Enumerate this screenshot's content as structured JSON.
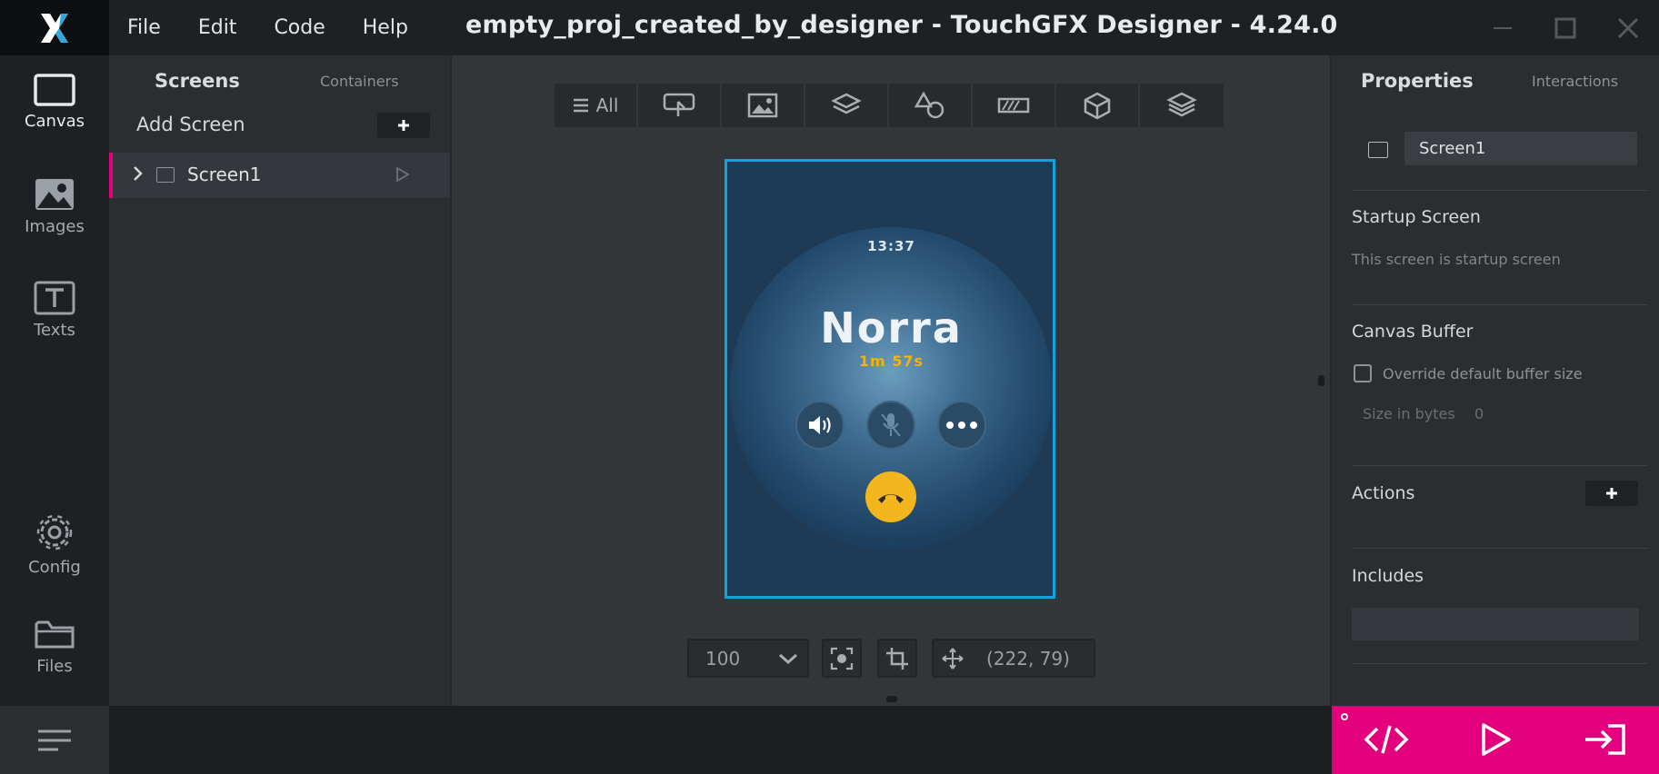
{
  "window": {
    "title": "empty_proj_created_by_designer - TouchGFX Designer - 4.24.0"
  },
  "menu": {
    "items": [
      "File",
      "Edit",
      "Code",
      "Help"
    ]
  },
  "leftnav": {
    "items": [
      {
        "label": "Canvas",
        "icon": "canvas-icon",
        "active": true
      },
      {
        "label": "Images",
        "icon": "image-icon"
      },
      {
        "label": "Texts",
        "icon": "text-icon"
      },
      {
        "label": "Config",
        "icon": "gear-icon"
      },
      {
        "label": "Files",
        "icon": "folder-icon"
      }
    ]
  },
  "screens_panel": {
    "tab_screens": "Screens",
    "tab_containers": "Containers",
    "add_screen_label": "Add Screen",
    "screens": [
      {
        "name": "Screen1"
      }
    ]
  },
  "toolbar": {
    "all_label": "All",
    "icons": [
      "interaction-icon",
      "image-icon",
      "container-icon",
      "shapes-icon",
      "progress-icon",
      "3d-icon",
      "layers-icon"
    ]
  },
  "canvas": {
    "watch": {
      "time": "13:37",
      "name": "Norra",
      "duration": "1m 57s"
    },
    "zoom": "100",
    "coordinates": "(222, 79)"
  },
  "properties": {
    "tab_properties": "Properties",
    "tab_interactions": "Interactions",
    "screen_name": "Screen1",
    "startup_title": "Startup Screen",
    "startup_text": "This screen is startup screen",
    "canvas_buffer_title": "Canvas Buffer",
    "override_label": "Override default buffer size",
    "size_label": "Size in bytes",
    "size_value": "0",
    "actions_title": "Actions",
    "includes_title": "Includes"
  },
  "colors": {
    "accent": "#e4007d",
    "selection": "#0fa3e2",
    "call_end": "#f3b61c",
    "duration": "#f4b400"
  }
}
